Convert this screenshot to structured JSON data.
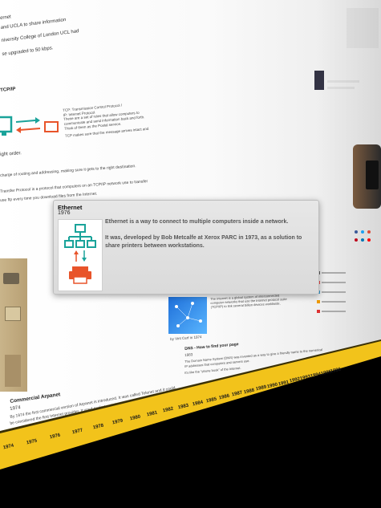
{
  "popup": {
    "title": "Ethernet",
    "year": "1976",
    "line1": "Ethernet is a way to connect to multiple computers inside a network.",
    "line2": "It was, developed by Bob Metcalfe at Xerox PARC in 1973, as a solution to share printers between workstations."
  },
  "top_left_text": [
    "ernet",
    "and UCLA to share information",
    "niversity College of London UCL had",
    "se upgraded to 50 kbps."
  ],
  "tcpip": {
    "heading": "TCP/IP",
    "lines": [
      "TCP: Transmission Control Protocol /",
      "IP: Internet Protocol",
      "These are a set of rules that allow computers to",
      "communicate and send information back and forth.",
      "Think of them as the Postal service.",
      "TCP makes sure that the message arrives intact and"
    ],
    "right_order": "ight order.",
    "routing": "charge of routing and addressing, making sure it gets to the right destination.",
    "ftp1": "Transfer Protocol is a protocol that computers on an TCP/IP network use to transfer",
    "ftp2": "use ftp every time you download files from the Internet."
  },
  "arpanet": {
    "title": "Commercial Arpanet",
    "year": "1974",
    "line1": "By 1974 the first commercial version of Arpanet is introduced. It was called Telenet and it could",
    "line2": "be considered the first Internet provider. It used packet switched communication."
  },
  "dns": {
    "title": "DNS - How to find your page",
    "year": "1983",
    "line1": "The Domain Name System (DNS) was invented as a way to give a friendly name to the numerical",
    "line2": "IP addresses that computers and servers use.",
    "line3": "It's like the \"phone book\" of the Internet."
  },
  "web_card": {
    "year": "1983",
    "desc": "The Internet is a global system of interconnected computer networks that use the Internet protocol suite (TCP/IP) to link several billion devices worldwide.",
    "caption": "by Vint Cerf in 1974"
  },
  "timeline_years": [
    "1974",
    "1975",
    "1976",
    "1977",
    "1978",
    "1979",
    "1980",
    "1981",
    "1982",
    "1983",
    "1984",
    "1985",
    "1986",
    "1987",
    "1988",
    "1989",
    "1990",
    "1991",
    "1992",
    "1993",
    "1994",
    "1995",
    "1996"
  ],
  "colors": {
    "band": "#f2c31b",
    "popup_bg": "#dedede",
    "icon_teal": "#1aa39a",
    "icon_orange": "#e8542a"
  }
}
